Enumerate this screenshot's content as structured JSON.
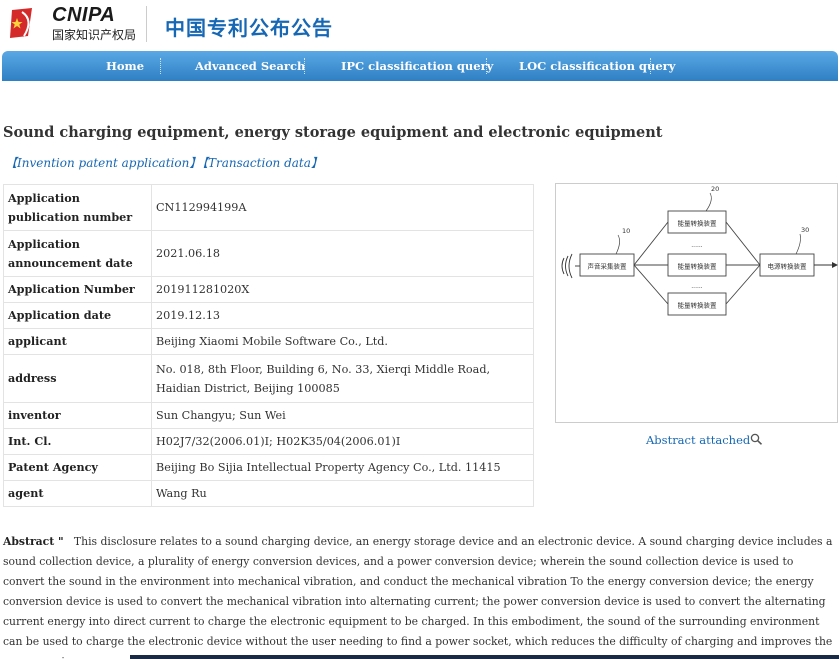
{
  "header": {
    "logo_en": "CNIPA",
    "logo_cn": "国家知识产权局",
    "site_title": "中国专利公布公告"
  },
  "nav": {
    "items": [
      {
        "label": "Home"
      },
      {
        "label": "Advanced Search"
      },
      {
        "label": "IPC classification query"
      },
      {
        "label": "LOC classification query"
      }
    ]
  },
  "page_title": "Sound charging equipment, energy storage equipment and electronic equipment",
  "tabs": [
    {
      "label": "【Invention patent application】"
    },
    {
      "label": "【Transaction data】"
    }
  ],
  "details": [
    {
      "key": "Application publication number",
      "value": "CN112994199A"
    },
    {
      "key": "Application announcement date",
      "value": "2021.06.18"
    },
    {
      "key": "Application Number",
      "value": "201911281020X"
    },
    {
      "key": "Application date",
      "value": "2019.12.13"
    },
    {
      "key": "applicant",
      "value": "Beijing Xiaomi Mobile Software Co., Ltd."
    },
    {
      "key": "address",
      "value": "No. 018, 8th Floor, Building 6, No. 33, Xierqi Middle Road, Haidian District, Beijing 100085"
    },
    {
      "key": "inventor",
      "value": "Sun Changyu; Sun Wei"
    },
    {
      "key": "Int. Cl.",
      "value": "H02J7/32(2006.01)I; H02K35/04(2006.01)I"
    },
    {
      "key": "Patent Agency",
      "value": "Beijing Bo Sijia Intellectual Property Agency Co., Ltd. 11415"
    },
    {
      "key": "agent",
      "value": "Wang Ru"
    }
  ],
  "figure": {
    "ref_10": "10",
    "ref_20": "20",
    "ref_30": "30",
    "box_collect": "声音采集装置",
    "box_convert": "能量转换装置",
    "box_power": "电源转换装置",
    "dots": "......"
  },
  "abstract_link": "Abstract attached",
  "abstract": {
    "label": "Abstract \"",
    "text": "This disclosure relates to a sound charging device, an energy storage device and an electronic device. A sound charging device includes a sound collection device, a plurality of energy conversion devices, and a power conversion device; wherein the sound collection device is used to convert the sound in the environment into mechanical vibration, and conduct the mechanical vibration To the energy conversion device; the energy conversion device is used to convert the mechanical vibration into alternating current; the power conversion device is used to convert the alternating current energy into direct current to charge the electronic equipment to be charged. In this embodiment, the sound of the surrounding environment can be used to charge the electronic device without the user needing to find a power socket, which reduces the difficulty of charging and improves the user experience."
  },
  "colors": {
    "nav_gradient_top": "#5aa8e4",
    "nav_gradient_bottom": "#2f7fc4",
    "link": "#1768b4",
    "logo_red": "#d42a2a"
  }
}
